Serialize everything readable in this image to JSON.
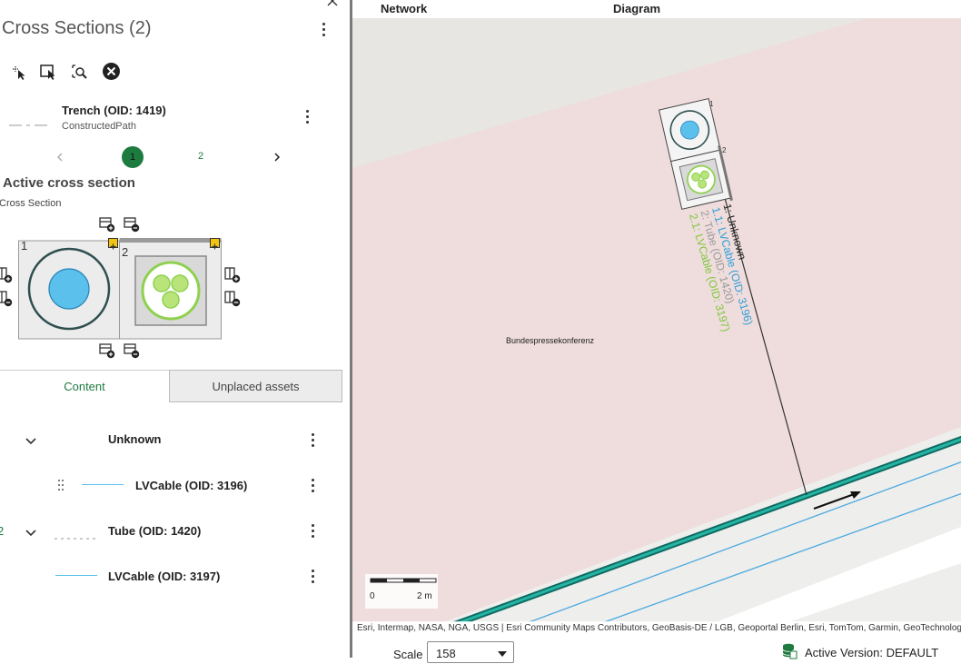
{
  "panel": {
    "title": "Cross Sections (2)",
    "feature": {
      "name": "Trench (OID: 1419)",
      "type": "ConstructedPath"
    },
    "pager": {
      "page1": "1",
      "page2": "2"
    },
    "active_heading": "Active cross section",
    "cross_section_label": "Cross Section",
    "diagram": {
      "cell1": "1",
      "cell2": "2"
    },
    "tabs": {
      "content": "Content",
      "unplaced": "Unplaced assets"
    },
    "tree": [
      {
        "label": "Unknown"
      },
      {
        "label": "LVCable (OID: 3196)"
      },
      {
        "label": "Tube (OID: 1420)",
        "index": "2"
      },
      {
        "label": "LVCable (OID: 3197)"
      }
    ]
  },
  "map": {
    "tabs": {
      "network": "Network",
      "diagram": "Diagram"
    },
    "place_label": "Bundespressekonferenz",
    "callout": {
      "line1": "1: Unknown",
      "line2": "1.1: LVCable (OID: 3196)",
      "line3": "2: Tube (OID: 1420)",
      "line4": "2.1: LVCable (OID: 3197)",
      "box1": "1",
      "box2": "2"
    },
    "scalebar": {
      "zero": "0",
      "end": "2 m"
    },
    "attribution": "Esri, Intermap, NASA, NGA, USGS | Esri Community Maps Contributors, GeoBasis-DE / LGB, Geoportal Berlin, Esri, TomTom, Garmin, GeoTechnologies",
    "scale_label": "Scale",
    "scale_value": "158",
    "active_version": "Active Version: DEFAULT"
  },
  "colors": {
    "accent_green": "#1e7b40",
    "cable_blue": "#5bc0eb",
    "tube_green": "#8fd14f",
    "map_pink": "#efdcdc"
  },
  "icons": [
    "close-icon",
    "kebab-icon",
    "select-icon",
    "select-box-icon",
    "zoom-select-icon",
    "clear-icon",
    "chevron-left-icon",
    "chevron-right-icon",
    "chevron-down-icon",
    "drag-handle-icon",
    "add-row-icon",
    "remove-row-icon",
    "database-icon"
  ]
}
